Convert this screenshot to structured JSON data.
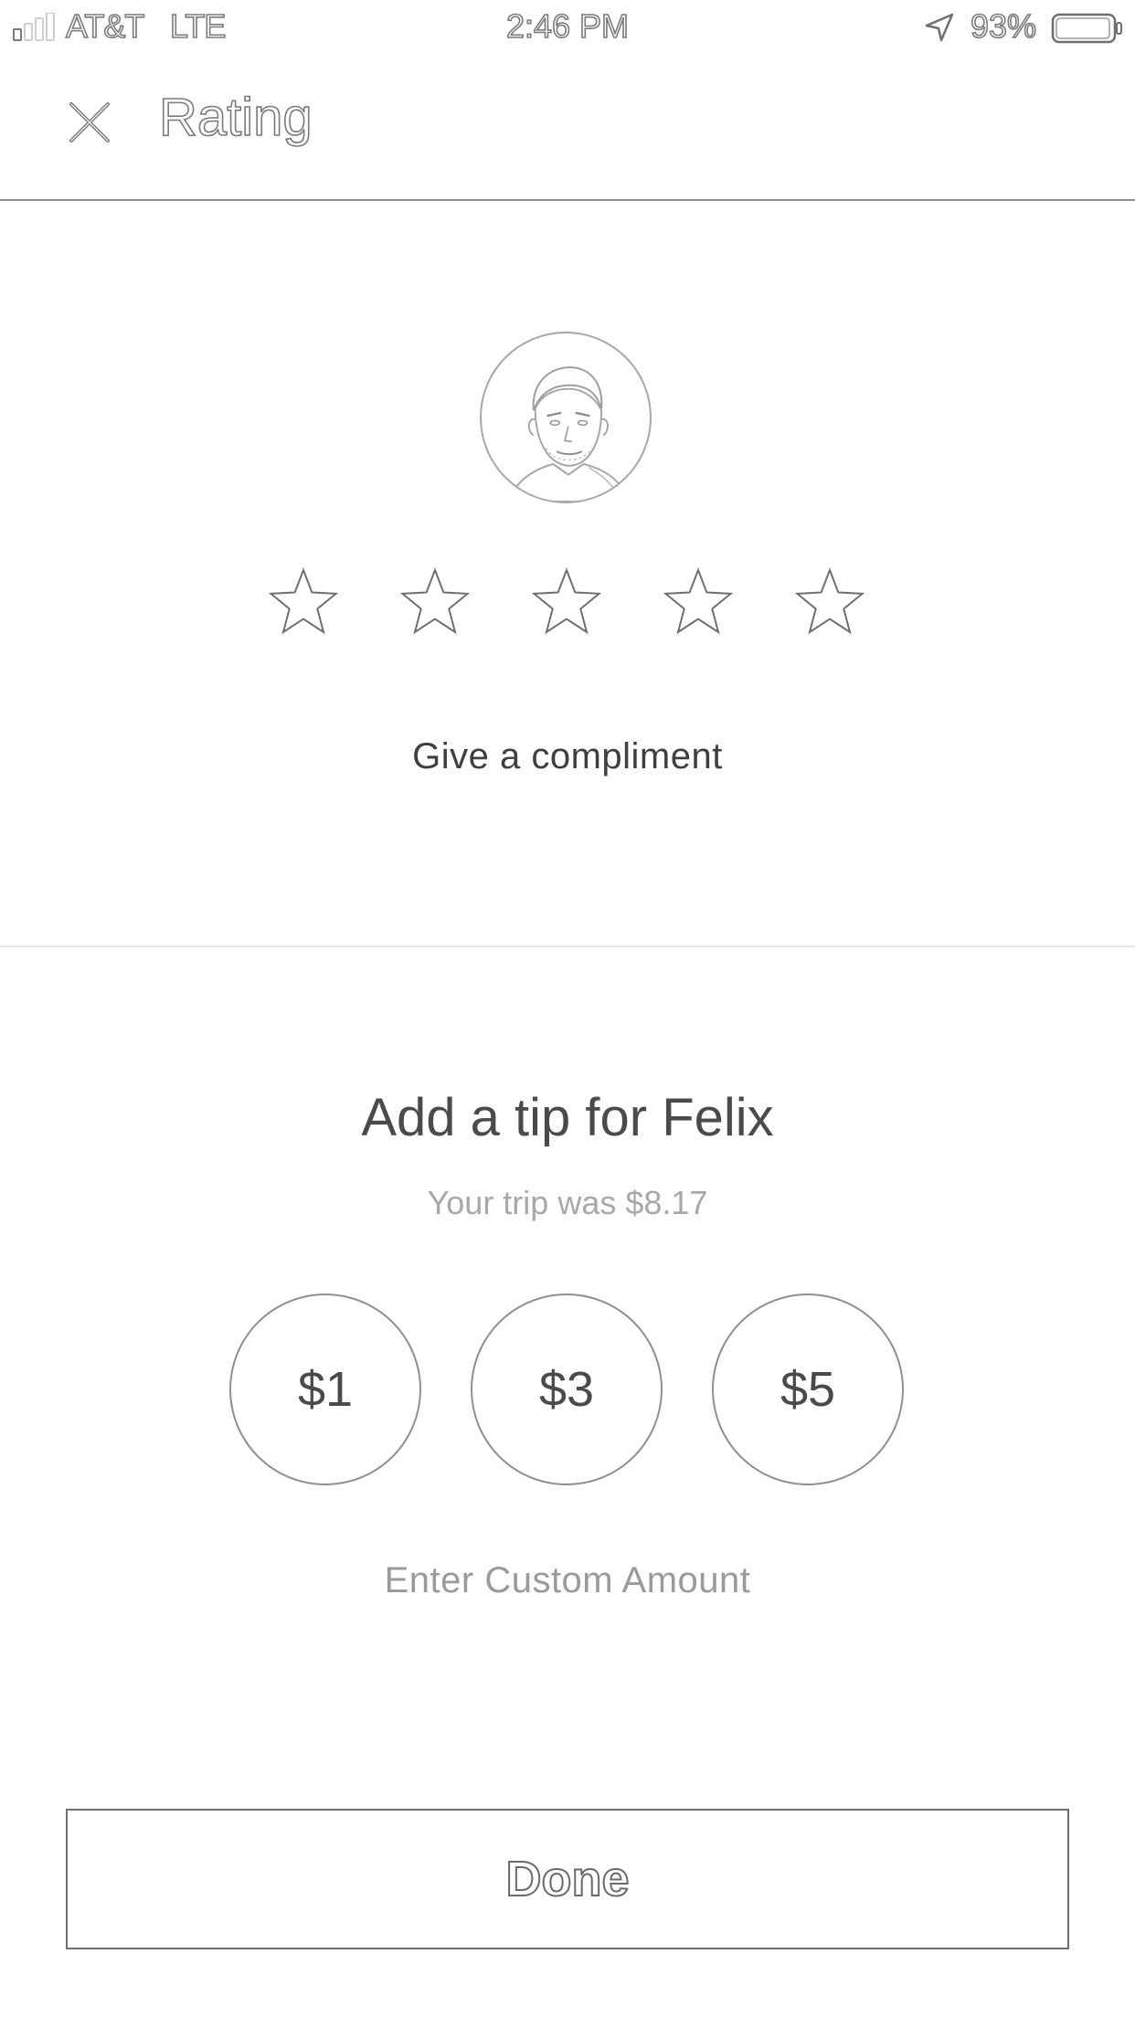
{
  "status_bar": {
    "carrier": "AT&T",
    "network": "LTE",
    "time": "2:46 PM",
    "battery_percent": "93%",
    "signal_bars_filled": 1,
    "signal_bars_total": 4,
    "battery_level": 0.93
  },
  "header": {
    "close_icon": "close-icon",
    "title": "Rating"
  },
  "rating": {
    "avatar_icon": "driver-photo",
    "stars_total": 5,
    "stars_selected": 0,
    "compliment_label": "Give a compliment"
  },
  "tip": {
    "title": "Add a tip for Felix",
    "fare_text": "Your trip was $8.17",
    "options": [
      "$1",
      "$3",
      "$5"
    ],
    "custom_amount_label": "Enter Custom Amount"
  },
  "footer": {
    "done_label": "Done"
  },
  "colors": {
    "background": "#ffffff",
    "text_primary": "#4a4a4a",
    "text_muted": "#a8a8a8",
    "border": "#8f8f8f"
  }
}
